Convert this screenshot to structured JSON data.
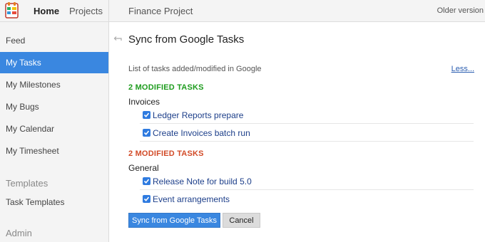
{
  "topbar": {
    "home_label": "Home",
    "projects_label": "Projects",
    "project_name": "Finance Project",
    "older_version": "Older version",
    "logo_icon": "app-logo-icon"
  },
  "sidebar": {
    "items": [
      {
        "label": "Feed",
        "active": false
      },
      {
        "label": "My Tasks",
        "active": true
      },
      {
        "label": "My Milestones",
        "active": false
      },
      {
        "label": "My Bugs",
        "active": false
      },
      {
        "label": "My Calendar",
        "active": false
      },
      {
        "label": "My Timesheet",
        "active": false
      }
    ],
    "templates_section": "Templates",
    "templates_items": [
      {
        "label": "Task Templates"
      }
    ],
    "admin_section": "Admin"
  },
  "main": {
    "title": "Sync from Google Tasks",
    "subtitle": "List of tasks added/modified in Google",
    "less_link": "Less...",
    "groups": [
      {
        "heading": "2 MODIFIED TASKS",
        "heading_color": "#1e9c1e",
        "label": "Invoices",
        "tasks": [
          {
            "label": "Ledger Reports prepare",
            "checked": true
          },
          {
            "label": "Create Invoices batch run",
            "checked": true
          }
        ]
      },
      {
        "heading": "2 MODIFIED TASKS",
        "heading_color": "#d24b28",
        "label": "General",
        "tasks": [
          {
            "label": "Release Note for build 5.0",
            "checked": true
          },
          {
            "label": "Event arrangements",
            "checked": true
          }
        ]
      }
    ],
    "sync_button": "Sync from Google Tasks",
    "cancel_button": "Cancel"
  },
  "colors": {
    "accent": "#3a87e0",
    "link": "#2a5db0"
  }
}
